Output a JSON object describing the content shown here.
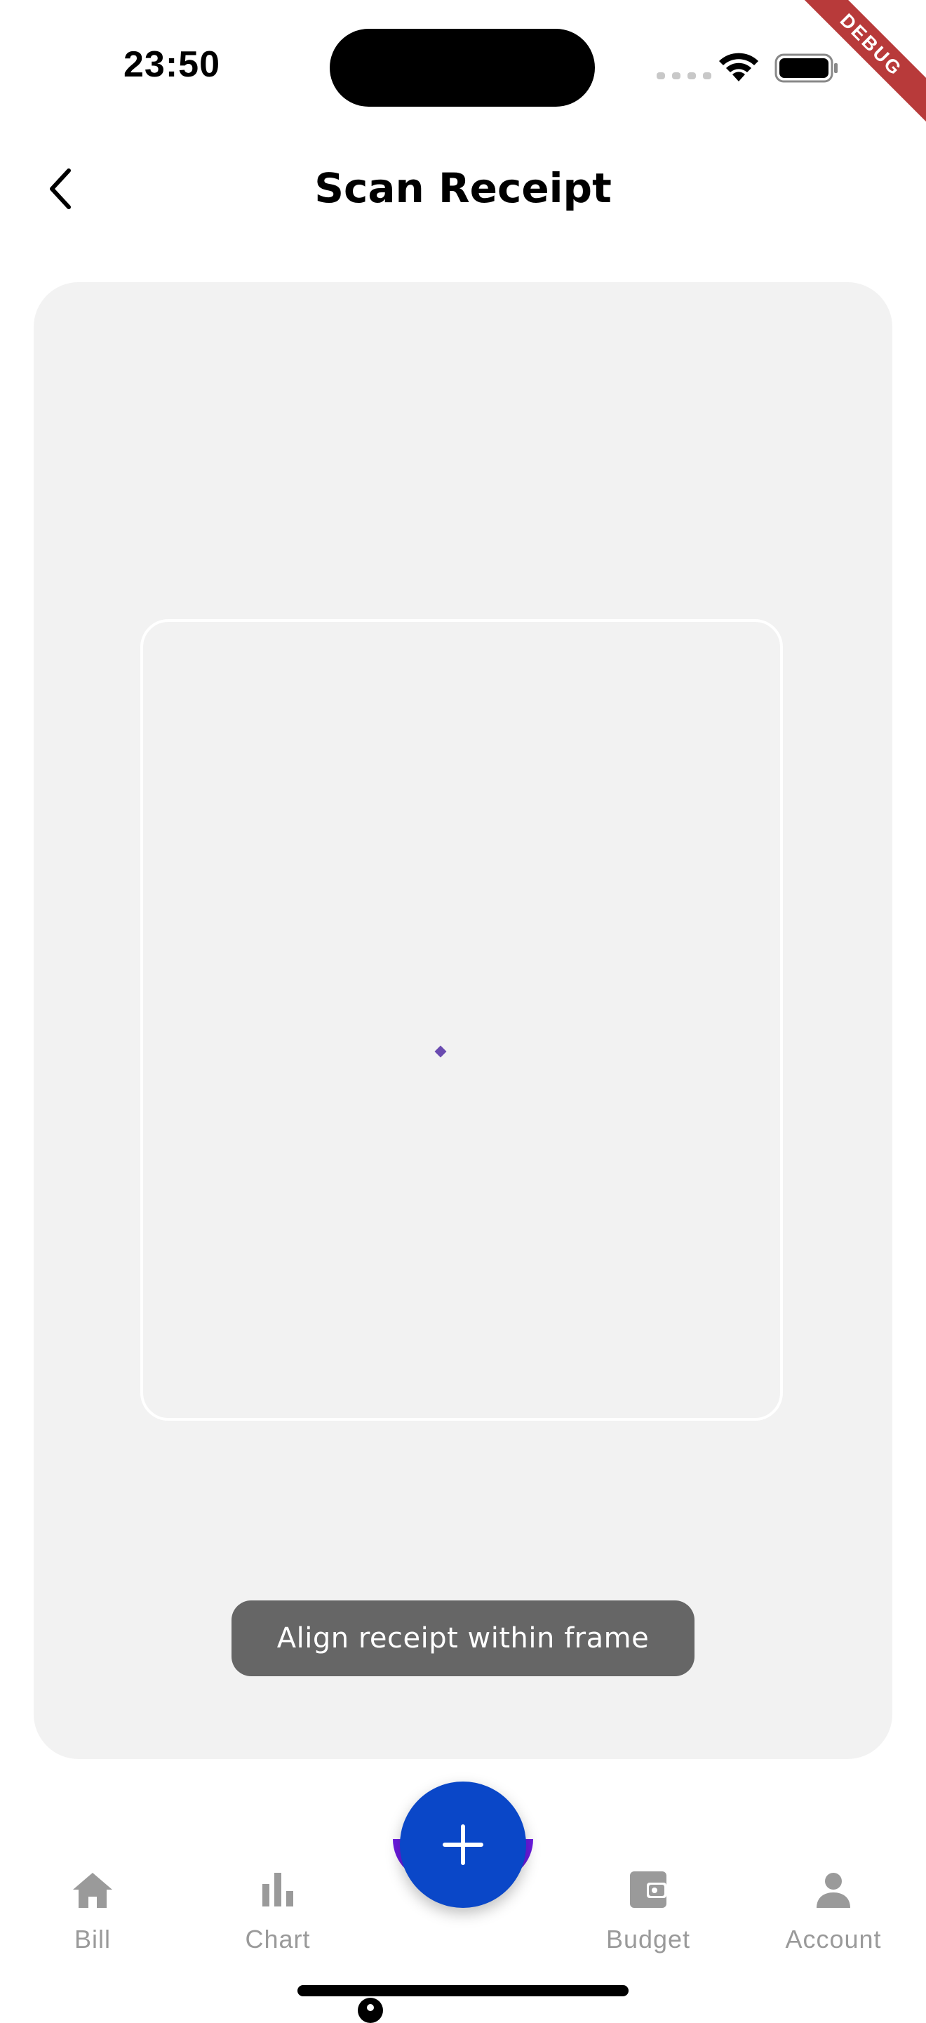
{
  "status_bar": {
    "time": "23:50",
    "debug_label": "DEBUG"
  },
  "header": {
    "title": "Scan Receipt",
    "back_icon": "chevron-left-icon"
  },
  "camera": {
    "hint": "Align receipt within frame",
    "focus_color": "#6a4bb0"
  },
  "fab": {
    "icon": "plus-icon",
    "color": "#0a47c8"
  },
  "nav": {
    "items": [
      {
        "label": "Bill",
        "icon": "home-icon"
      },
      {
        "label": "Chart",
        "icon": "bar-chart-icon"
      },
      {
        "label": "Budget",
        "icon": "wallet-icon"
      },
      {
        "label": "Account",
        "icon": "person-icon"
      }
    ],
    "inactive_color": "#9a9a9a"
  }
}
